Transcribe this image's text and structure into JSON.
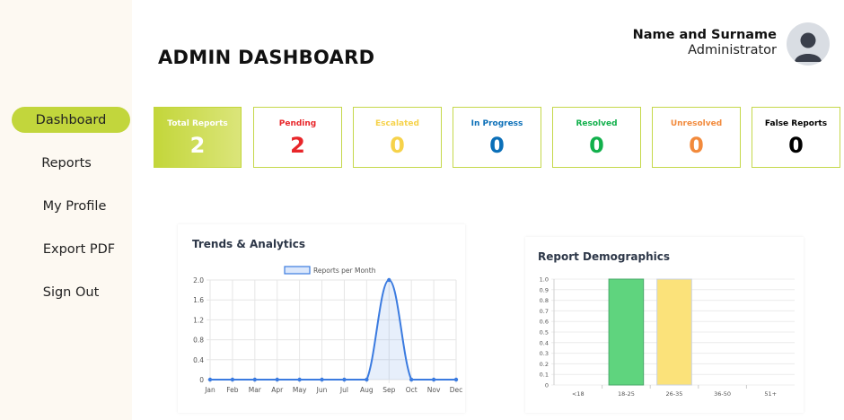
{
  "sidebar": {
    "items": [
      {
        "label": "Dashboard",
        "active": true
      },
      {
        "label": "Reports",
        "active": false
      },
      {
        "label": "My Profile",
        "active": false
      },
      {
        "label": "Export PDF",
        "active": false
      },
      {
        "label": "Sign Out",
        "active": false
      }
    ]
  },
  "header": {
    "title": "ADMIN DASHBOARD",
    "user_name": "Name and Surname",
    "user_role": "Administrator",
    "avatar_icon": "user-avatar-icon"
  },
  "colors": {
    "accent": "#c2d63c",
    "pending": "#e8262a",
    "escalated": "#f6d24a",
    "in_progress": "#0b6fb8",
    "resolved": "#12b04c",
    "unresolved": "#f28a3c",
    "false_reports": "#000000",
    "line": "#3b7be0",
    "bar_green": "#5fd47e",
    "bar_yellow": "#fbe27a"
  },
  "cards": [
    {
      "label": "Total Reports",
      "value": "2",
      "color": "#ffffff"
    },
    {
      "label": "Pending",
      "value": "2",
      "color": "#e8262a"
    },
    {
      "label": "Escalated",
      "value": "0",
      "color": "#f6d24a"
    },
    {
      "label": "In Progress",
      "value": "0",
      "color": "#0b6fb8"
    },
    {
      "label": "Resolved",
      "value": "0",
      "color": "#12b04c"
    },
    {
      "label": "Unresolved",
      "value": "0",
      "color": "#f28a3c"
    },
    {
      "label": "False Reports",
      "value": "0",
      "color": "#000000"
    }
  ],
  "chart_data": [
    {
      "type": "line",
      "title": "Trends & Analytics",
      "categories": [
        "Jan",
        "Feb",
        "Mar",
        "Apr",
        "May",
        "Jun",
        "Jul",
        "Aug",
        "Sep",
        "Oct",
        "Nov",
        "Dec"
      ],
      "series": [
        {
          "name": "Reports per Month",
          "values": [
            0,
            0,
            0,
            0,
            0,
            0,
            0,
            0,
            2,
            0,
            0,
            0
          ]
        }
      ],
      "yticks": [
        "0",
        "0.4",
        "0.8",
        "1.2",
        "1.6",
        "2.0"
      ],
      "ylim": [
        0,
        2
      ],
      "fill": true,
      "grid": true,
      "legend": "top"
    },
    {
      "type": "bar",
      "title": "Report Demographics",
      "categories": [
        "<18",
        "18-25",
        "26-35",
        "36-50",
        "51+"
      ],
      "values": [
        0,
        1,
        1,
        0,
        0
      ],
      "colors": [
        "#5fd47e",
        "#5fd47e",
        "#fbe27a",
        "#5fd47e",
        "#5fd47e"
      ],
      "yticks": [
        "0",
        "0.1",
        "0.2",
        "0.3",
        "0.4",
        "0.5",
        "0.6",
        "0.7",
        "0.8",
        "0.9",
        "1.0"
      ],
      "ylim": [
        0,
        1
      ],
      "grid": true
    }
  ]
}
